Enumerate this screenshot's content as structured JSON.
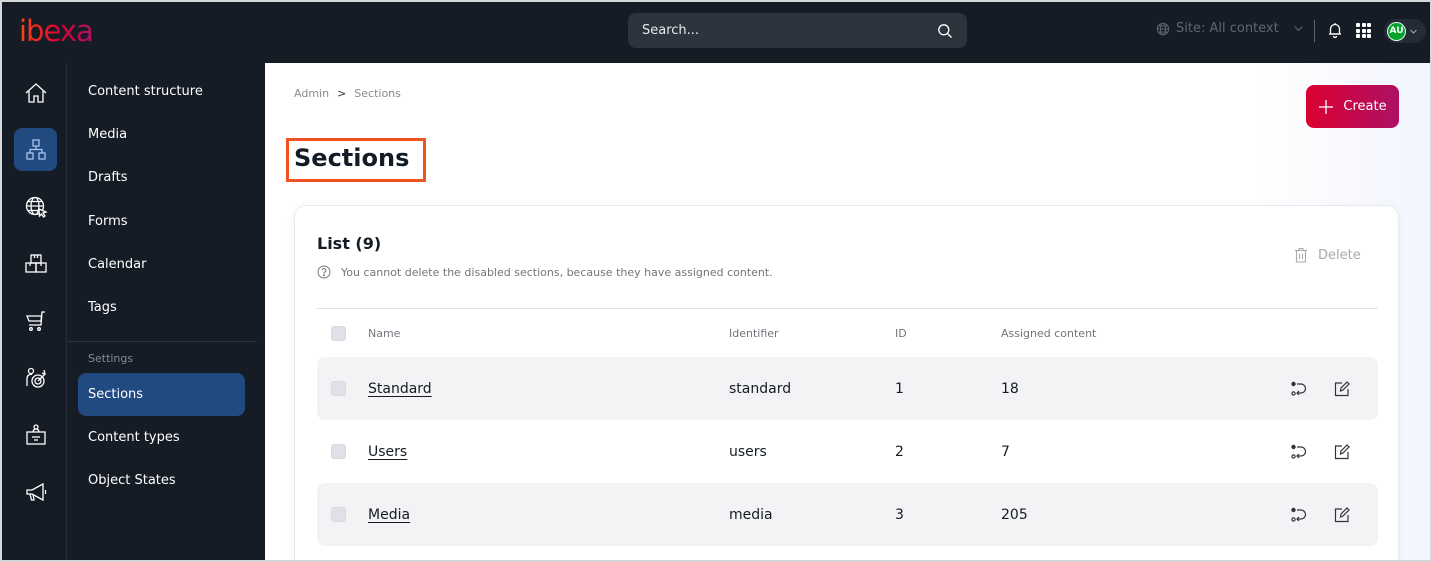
{
  "app": {
    "logo_text": "ibexa",
    "brand_colors": {
      "primary": "#db0032",
      "secondary": "#ae1164",
      "accent_orange": "#ff4713",
      "nav_active": "#204a80",
      "dark_bg": "#151c26"
    }
  },
  "topbar": {
    "search_placeholder": "Search...",
    "search_icon": "search-icon",
    "site_context_label": "Site: All context",
    "site_context_icon": "globe-icon",
    "notifications_icon": "bell-icon",
    "apps_icon": "grid-icon",
    "user_initials": "AU"
  },
  "rail": {
    "items": [
      {
        "icon": "home-icon",
        "active": false
      },
      {
        "icon": "content-structure-icon",
        "active": true
      },
      {
        "icon": "site-globe-icon",
        "active": false
      },
      {
        "icon": "product-boxes-icon",
        "active": false
      },
      {
        "icon": "cart-icon",
        "active": false
      },
      {
        "icon": "customer-target-icon",
        "active": false
      },
      {
        "icon": "badge-icon",
        "active": false
      },
      {
        "icon": "megaphone-icon",
        "active": false
      }
    ]
  },
  "subnav": {
    "items": [
      {
        "label": "Content structure"
      },
      {
        "label": "Media"
      },
      {
        "label": "Drafts"
      },
      {
        "label": "Forms"
      },
      {
        "label": "Calendar"
      },
      {
        "label": "Tags"
      }
    ],
    "settings_group_label": "Settings",
    "settings_items": [
      {
        "label": "Sections",
        "active": true
      },
      {
        "label": "Content types",
        "active": false
      },
      {
        "label": "Object States",
        "active": false
      }
    ]
  },
  "breadcrumb": {
    "items": [
      "Admin",
      "Sections"
    ],
    "separator": ">"
  },
  "page": {
    "title": "Sections",
    "create_label": "Create"
  },
  "list": {
    "title": "List (9)",
    "note": "You cannot delete the disabled sections, because they have assigned content.",
    "delete_label": "Delete",
    "columns": {
      "name": "Name",
      "identifier": "Identifier",
      "id": "ID",
      "assigned": "Assigned content"
    },
    "rows": [
      {
        "name": "Standard",
        "identifier": "standard",
        "id": "1",
        "assigned": "18"
      },
      {
        "name": "Users",
        "identifier": "users",
        "id": "2",
        "assigned": "7"
      },
      {
        "name": "Media",
        "identifier": "media",
        "id": "3",
        "assigned": "205"
      }
    ],
    "row_actions": [
      "assign-icon",
      "edit-icon"
    ]
  }
}
